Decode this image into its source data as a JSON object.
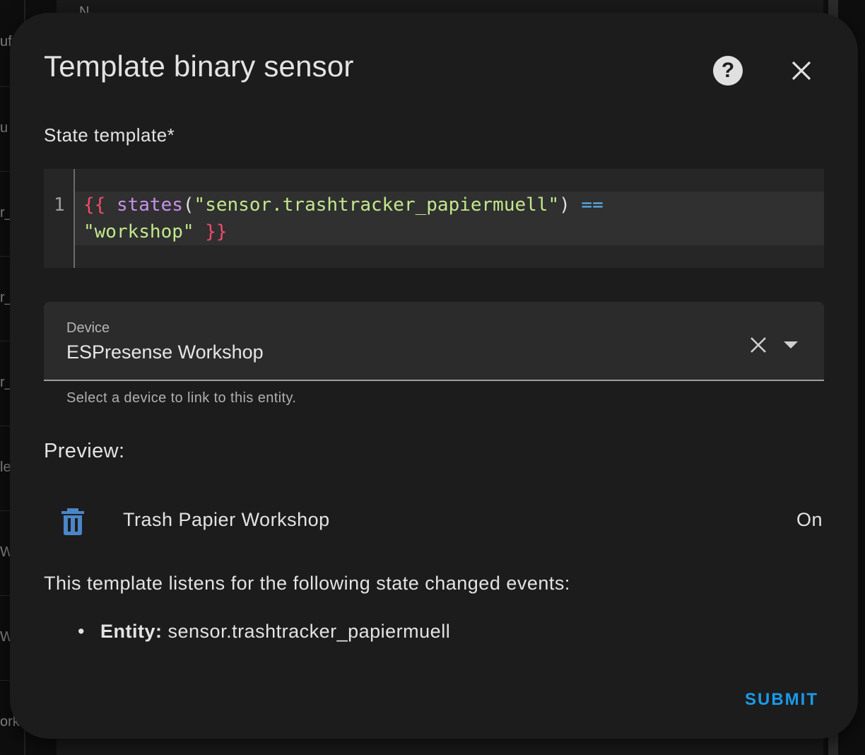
{
  "background": {
    "fragments": [
      "uf",
      "u",
      "r_",
      "r_",
      "r_",
      "le",
      "W",
      "W",
      "ork",
      "N"
    ]
  },
  "dialog": {
    "title": "Template binary sensor",
    "help_icon": "help-circle-icon",
    "close_icon": "close-icon"
  },
  "state_template": {
    "label": "State template*",
    "line_number": "1",
    "code": {
      "open": "{{",
      "fn": "states",
      "lparen": "(",
      "arg": "\"sensor.trashtracker_papiermuell\"",
      "rparen": ")",
      "op": "==",
      "compare": "\"workshop\"",
      "close": "}}"
    }
  },
  "device": {
    "label": "Device",
    "value": "ESPresense Workshop",
    "helper": "Select a device to link to this entity.",
    "clear_icon": "close-icon",
    "dropdown_icon": "menu-down-icon"
  },
  "preview": {
    "label": "Preview:",
    "entity_icon": "trash-can-icon",
    "entity_name": "Trash Papier Workshop",
    "entity_state": "On"
  },
  "listeners": {
    "intro": "This template listens for the following state changed events:",
    "items": [
      {
        "key": "Entity",
        "value": "sensor.trashtracker_papiermuell"
      }
    ]
  },
  "actions": {
    "submit_label": "SUBMIT"
  },
  "colors": {
    "accent": "#1a9aea",
    "icon_blue": "#4a86c8",
    "dialog_bg": "#1c1c1c"
  }
}
